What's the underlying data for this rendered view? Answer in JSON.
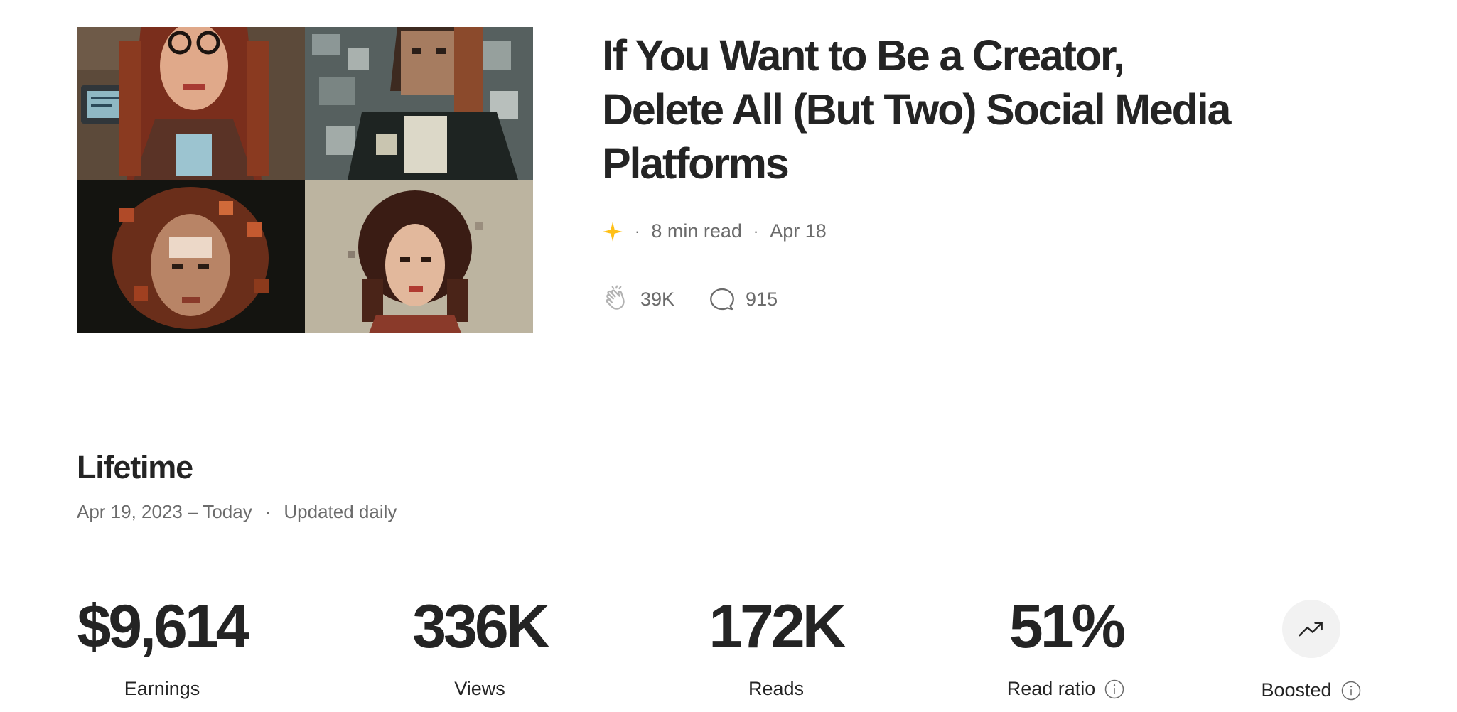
{
  "article": {
    "title": "If You Want to Be a Creator, Delete All (But Two) Social Media Platforms",
    "read_time": "8 min read",
    "date": "Apr 18",
    "claps": "39K",
    "responses": "915",
    "member_badge_color": "#FFC017"
  },
  "lifetime": {
    "heading": "Lifetime",
    "range": "Apr 19, 2023 – Today",
    "update_note": "Updated daily"
  },
  "stats": {
    "earnings": {
      "value": "$9,614",
      "label": "Earnings"
    },
    "views": {
      "value": "336K",
      "label": "Views"
    },
    "reads": {
      "value": "172K",
      "label": "Reads"
    },
    "read_ratio": {
      "value": "51%",
      "label": "Read ratio"
    },
    "boosted": {
      "label": "Boosted"
    }
  },
  "icons": {
    "member": "star-icon",
    "claps": "clap-icon",
    "responses": "comment-icon",
    "info": "info-icon",
    "boost": "trending-up-icon"
  }
}
